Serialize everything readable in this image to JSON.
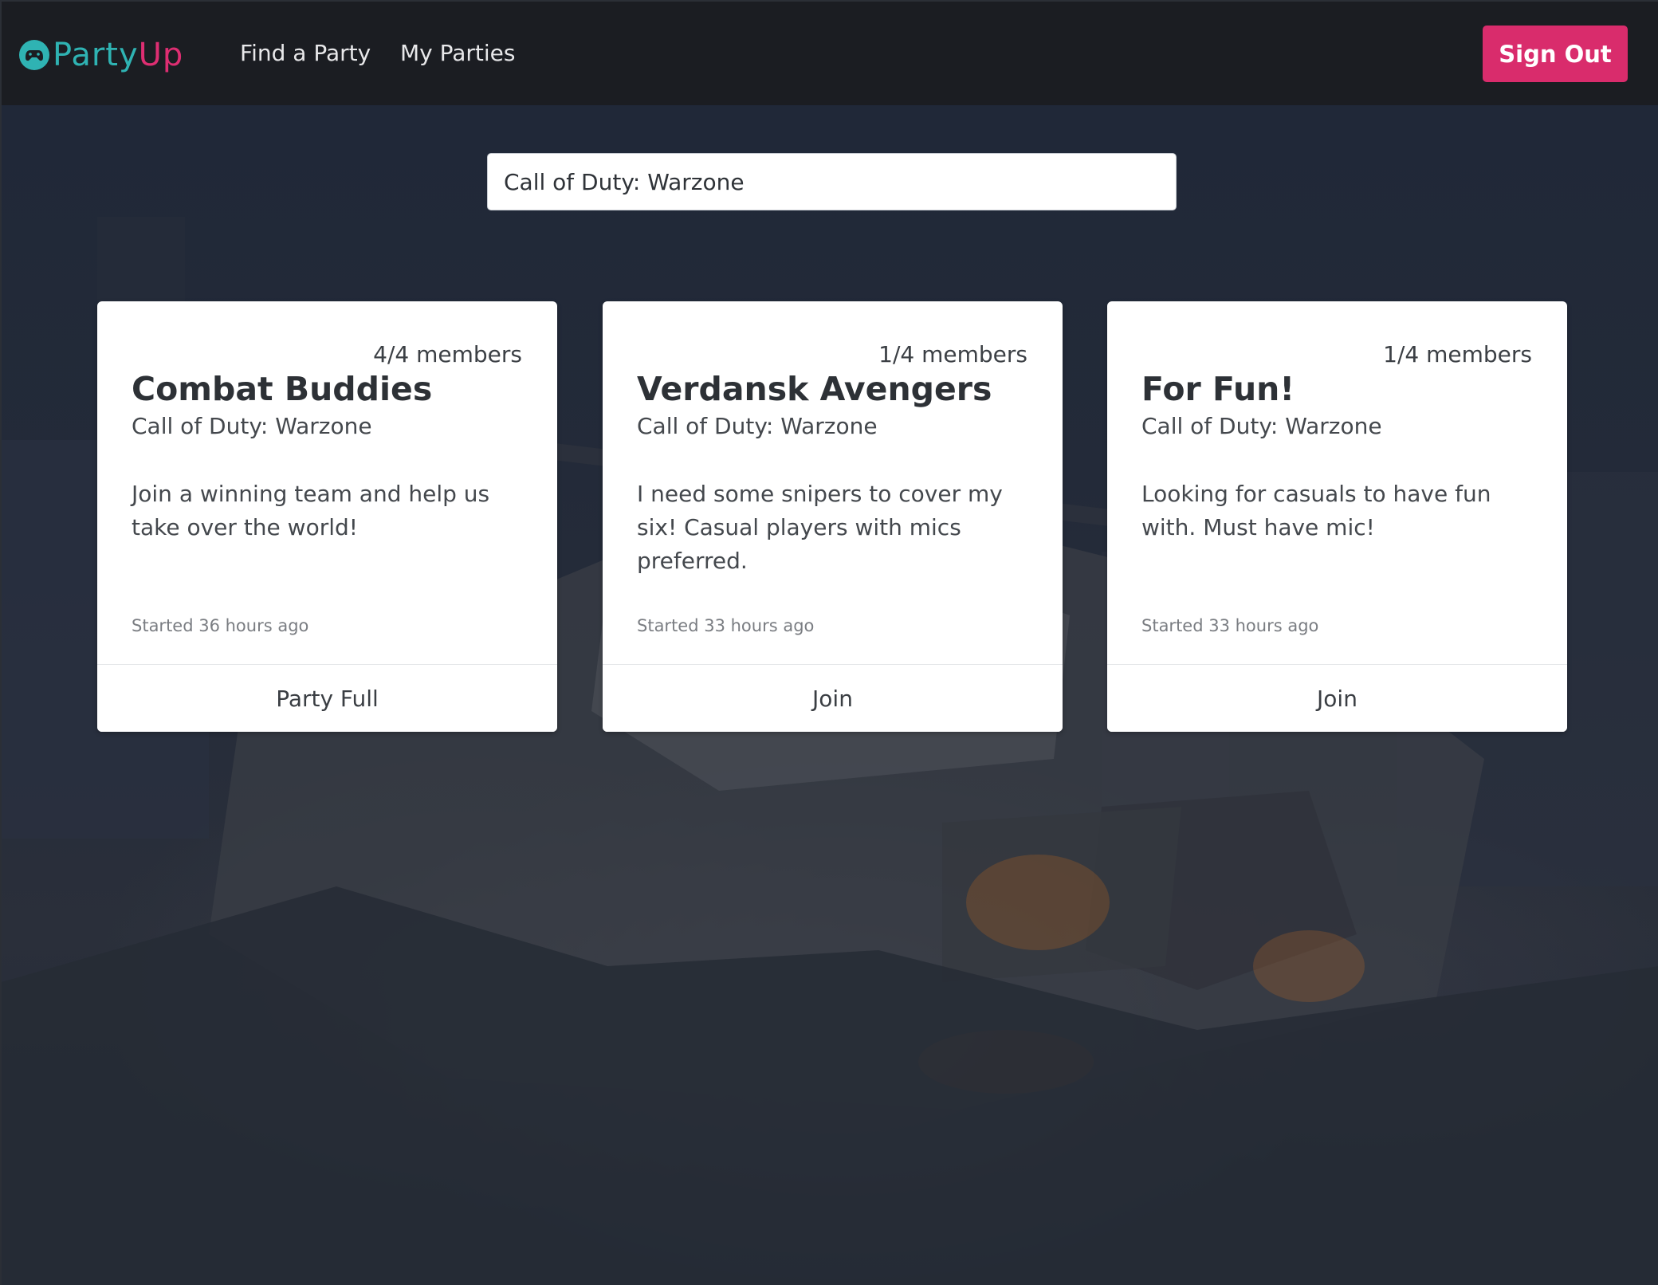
{
  "brand": {
    "name_part1": "Party",
    "name_part2": "Up",
    "icon": "gamepad-icon"
  },
  "nav": {
    "find_party": "Find a Party",
    "my_parties": "My Parties",
    "sign_out": "Sign Out"
  },
  "search": {
    "value": "Call of Duty: Warzone"
  },
  "colors": {
    "brand_teal": "#2fb3b3",
    "brand_pink": "#de2e72",
    "accent": "#d92c6c",
    "header_bg": "#1b1d22"
  },
  "parties": [
    {
      "members": "4/4 members",
      "title": "Combat Buddies",
      "game": "Call of Duty: Warzone",
      "description": "Join a winning team and help us take over the world!",
      "started": "Started 36 hours ago",
      "action": "Party Full"
    },
    {
      "members": "1/4 members",
      "title": "Verdansk Avengers",
      "game": "Call of Duty: Warzone",
      "description": "I need some snipers to cover my six! Casual players with mics preferred.",
      "started": "Started 33 hours ago",
      "action": "Join"
    },
    {
      "members": "1/4 members",
      "title": "For Fun!",
      "game": "Call of Duty: Warzone",
      "description": "Looking for casuals to have fun with. Must have mic!",
      "started": "Started 33 hours ago",
      "action": "Join"
    }
  ]
}
